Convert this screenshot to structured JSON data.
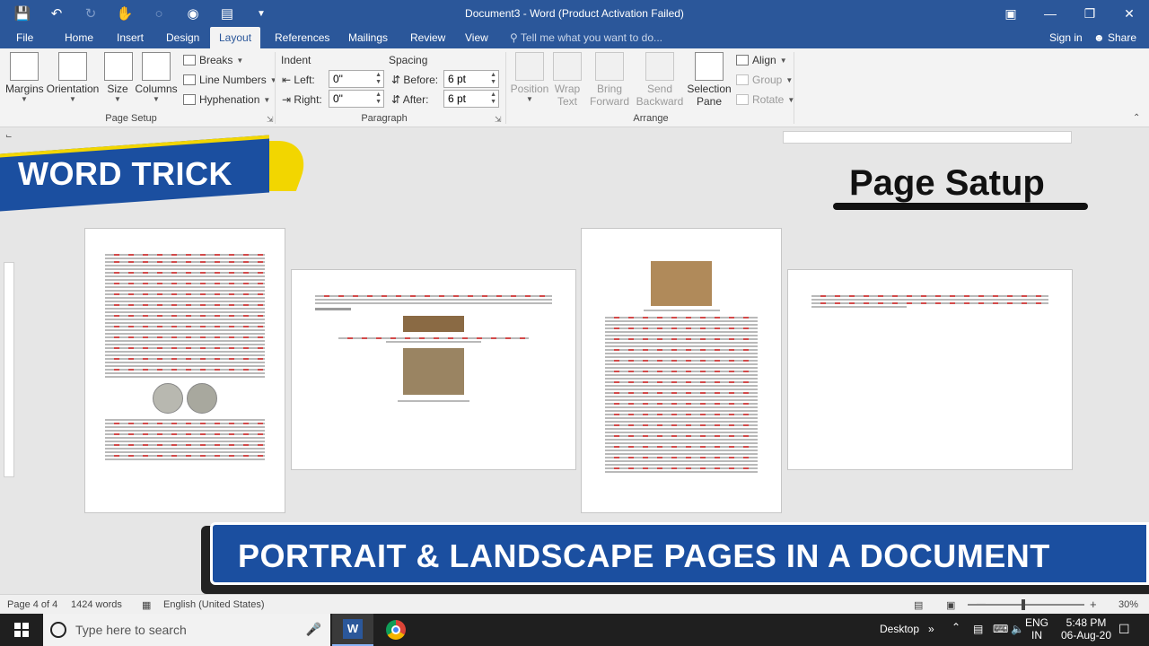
{
  "window": {
    "title": "Document3 - Word (Product Activation Failed)"
  },
  "ribbon_tabs": [
    "File",
    "Home",
    "Insert",
    "Design",
    "Layout",
    "References",
    "Mailings",
    "Review",
    "View"
  ],
  "active_tab": "Layout",
  "tell_me": "Tell me what you want to do...",
  "account": {
    "signin": "Sign in",
    "share": "Share"
  },
  "page_setup": {
    "margins": "Margins",
    "orientation": "Orientation",
    "size": "Size",
    "columns": "Columns",
    "breaks": "Breaks",
    "line_numbers": "Line Numbers",
    "hyphenation": "Hyphenation",
    "label": "Page Setup"
  },
  "paragraph": {
    "indent_label": "Indent",
    "spacing_label": "Spacing",
    "left_label": "Left:",
    "right_label": "Right:",
    "before_label": "Before:",
    "after_label": "After:",
    "left_value": "0\"",
    "right_value": "0\"",
    "before_value": "6 pt",
    "after_value": "6 pt",
    "label": "Paragraph"
  },
  "arrange": {
    "position": "Position",
    "wrap_text_1": "Wrap",
    "wrap_text_2": "Text",
    "bring_forward_1": "Bring",
    "bring_forward_2": "Forward",
    "send_backward_1": "Send",
    "send_backward_2": "Backward",
    "selection_pane_1": "Selection",
    "selection_pane_2": "Pane",
    "align": "Align",
    "group": "Group",
    "rotate": "Rotate",
    "label": "Arrange"
  },
  "overlays": {
    "word_trick": "WORD TRICK",
    "page_satup": "Page Satup",
    "bottom_banner": "PORTRAIT & LANDSCAPE PAGES IN A DOCUMENT"
  },
  "status": {
    "page": "Page 4 of 4",
    "words": "1424 words",
    "language": "English (United States)",
    "zoom": "30%"
  },
  "taskbar": {
    "search_placeholder": "Type here to search",
    "desktop": "Desktop",
    "lang_1": "ENG",
    "lang_2": "IN",
    "time": "5:48 PM",
    "date": "06-Aug-20"
  },
  "colors": {
    "word_blue": "#2b579a",
    "banner_blue": "#1b4fa0",
    "banner_yellow": "#f2d600"
  }
}
